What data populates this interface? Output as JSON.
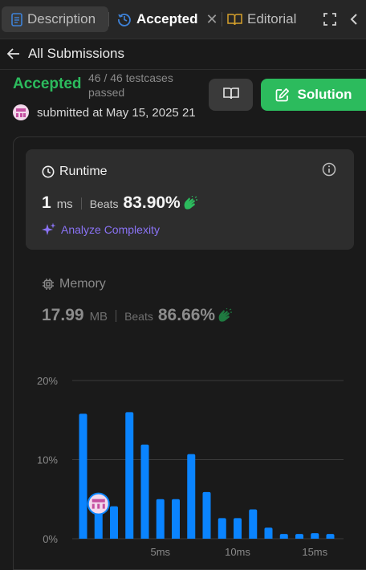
{
  "tabs": [
    {
      "label": "Description",
      "icon": "description-icon"
    },
    {
      "label": "Accepted",
      "icon": "history-icon",
      "close": "✕"
    },
    {
      "label": "Editorial",
      "icon": "book-icon"
    }
  ],
  "back": {
    "label": "All Submissions"
  },
  "submission": {
    "status": "Accepted",
    "testcases": "46 / 46 testcases passed",
    "submitted": "submitted at May 15, 2025 21"
  },
  "buttons": {
    "solution": "Solution"
  },
  "runtime": {
    "title": "Runtime",
    "value": "1",
    "unit": "ms",
    "beats_label": "Beats",
    "beats": "83.90%",
    "analyze": "Analyze Complexity"
  },
  "memory": {
    "title": "Memory",
    "value": "17.99",
    "unit": "MB",
    "beats_label": "Beats",
    "beats": "86.66%"
  },
  "colors": {
    "accent_green": "#2cbb5d",
    "bar_blue": "#0a84ff",
    "analyze_purple": "#8a73f5"
  },
  "chart_data": {
    "type": "bar",
    "y_ticks": [
      "20%",
      "10%",
      "0%"
    ],
    "ylim": [
      0,
      20
    ],
    "x_ticks": [
      {
        "label": "5ms",
        "bar_index": 5
      },
      {
        "label": "10ms",
        "bar_index": 10
      },
      {
        "label": "15ms",
        "bar_index": 15
      }
    ],
    "values": [
      15.8,
      4.2,
      4.1,
      16.0,
      11.9,
      5.0,
      5.0,
      10.7,
      5.9,
      2.6,
      2.6,
      3.7,
      1.4,
      0.6,
      0.6,
      0.7,
      0.6
    ],
    "user_bar_index": 1
  }
}
